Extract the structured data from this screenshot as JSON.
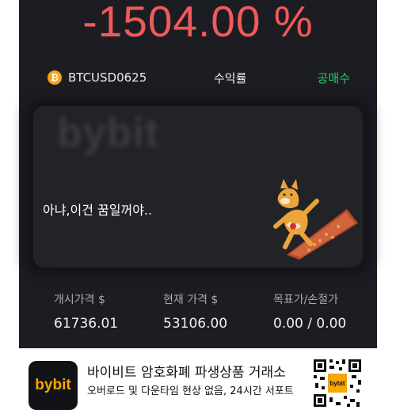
{
  "pnl": "-1504.00 %",
  "contract": {
    "coin_glyph": "₿",
    "coin_color": "#f7a21b",
    "symbol": "BTCUSD0625",
    "metric_label": "수익률",
    "side": "공매수",
    "side_color": "#35c46b"
  },
  "banner": {
    "watermark": "bybit",
    "quote": "아냐,이건 꿈일꺼야.."
  },
  "stats": {
    "entry_label": "개시가격 $",
    "entry_value": "61736.01",
    "current_label": "현재 가격 $",
    "current_value": "53106.00",
    "tpsl_label": "목표가/손절가",
    "tpsl_value": "0.00 / 0.00"
  },
  "footer": {
    "app_icon_text": "bybit",
    "title": "바이비트 암호화폐 파생상품 거래소",
    "subtitle": "오버로드 및 다운타임 현상 없음, 24시간 서포트",
    "qr_label": "bybit"
  }
}
